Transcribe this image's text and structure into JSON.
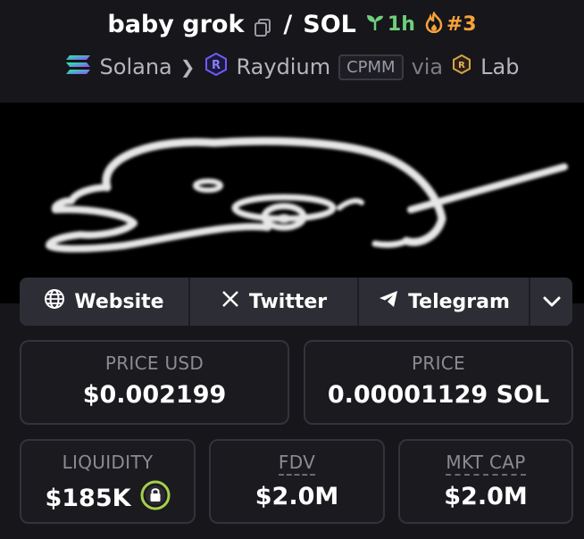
{
  "token": {
    "name": "baby grok",
    "quote": "SOL",
    "separator": "/",
    "age": "1h",
    "rank": "#3"
  },
  "route": {
    "chain": "Solana",
    "dex": "Raydium",
    "pool_type": "CPMM",
    "via_label": "via",
    "launchpad": "Lab"
  },
  "links": {
    "website": "Website",
    "twitter": "Twitter",
    "telegram": "Telegram"
  },
  "stats": {
    "price_usd_label": "PRICE USD",
    "price_usd_value": "$0.002199",
    "price_label": "PRICE",
    "price_value": "0.00001129 SOL",
    "liquidity_label": "LIQUIDITY",
    "liquidity_value": "$185K",
    "fdv_label": "FDV",
    "fdv_value": "$2.0M",
    "mktcap_label": "MKT CAP",
    "mktcap_value": "$2.0M"
  },
  "colors": {
    "background": "#16161b",
    "age_green": "#6fcf7a",
    "rank_orange": "#f7a23a",
    "lock_ring": "#a6cf4a",
    "card_border": "#33333b"
  },
  "icons": [
    "copy-icon",
    "seedling-icon",
    "flame-icon",
    "solana-icon",
    "raydium-icon",
    "lab-icon",
    "globe-icon",
    "x-icon",
    "telegram-icon",
    "chevron-down-icon",
    "lock-icon"
  ]
}
